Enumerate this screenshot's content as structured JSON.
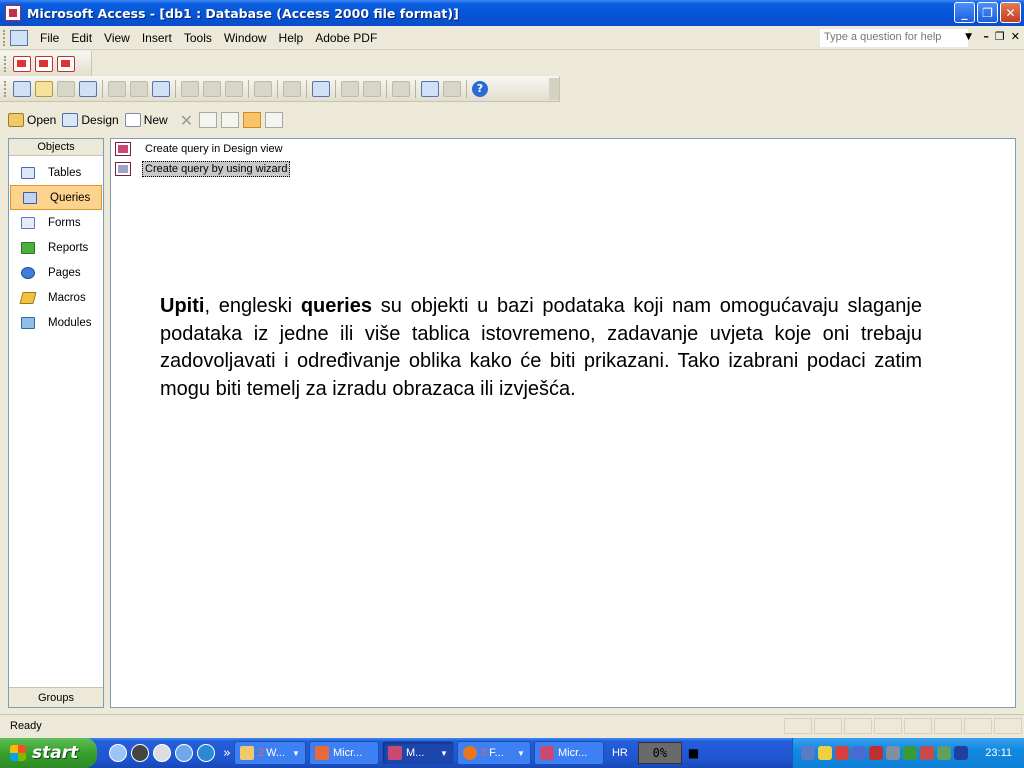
{
  "window": {
    "title": "Microsoft Access - [db1 : Database (Access 2000 file format)]",
    "minimize": "_",
    "restore": "❐",
    "close": "✕"
  },
  "menubar": {
    "items": [
      "File",
      "Edit",
      "View",
      "Insert",
      "Tools",
      "Window",
      "Help",
      "Adobe PDF"
    ],
    "help_placeholder": "Type a question for help",
    "mdi": [
      "–",
      "❐",
      "✕"
    ]
  },
  "db_toolbar": {
    "open": "Open",
    "design": "Design",
    "new": "New"
  },
  "objects": {
    "header": "Objects",
    "items": [
      {
        "label": "Tables",
        "icon": "table-icon"
      },
      {
        "label": "Queries",
        "icon": "query-icon",
        "active": true
      },
      {
        "label": "Forms",
        "icon": "form-icon"
      },
      {
        "label": "Reports",
        "icon": "report-icon"
      },
      {
        "label": "Pages",
        "icon": "page-icon"
      },
      {
        "label": "Macros",
        "icon": "macro-icon"
      },
      {
        "label": "Modules",
        "icon": "module-icon"
      }
    ],
    "footer": "Groups"
  },
  "queries_list": [
    {
      "label": "Create query in Design view",
      "selected": false
    },
    {
      "label": "Create query by using wizard",
      "selected": true
    }
  ],
  "explanation": {
    "term1": "Upiti",
    "text1": ", engleski ",
    "term2": "queries",
    "text2": " su objekti u bazi podataka koji nam omogućavaju slaganje podataka iz jedne ili više tablica istovremeno, zadavanje uvjeta koje oni trebaju zadovoljavati i određivanje oblika kako će biti prikazani. Tako izabrani podaci zatim mogu biti temelj za izradu obrazaca ili izvješća."
  },
  "status": "Ready",
  "taskbar": {
    "start": "start",
    "tasks": [
      {
        "num": "2",
        "label": "W...",
        "arrow": true,
        "active": false,
        "color": "#f2c96a"
      },
      {
        "num": "",
        "label": "Micr...",
        "arrow": false,
        "active": false,
        "color": "#e86a3a"
      },
      {
        "num": "",
        "label": "M...",
        "arrow": true,
        "active": true,
        "color": "#c84a72"
      },
      {
        "num": "3",
        "label": "F...",
        "arrow": true,
        "active": false,
        "color": "#e8781e"
      },
      {
        "num": "",
        "label": "Micr...",
        "arrow": false,
        "active": false,
        "color": "#c84a72"
      }
    ],
    "lang": "HR",
    "cpu": "0%",
    "clock": "23:11"
  }
}
